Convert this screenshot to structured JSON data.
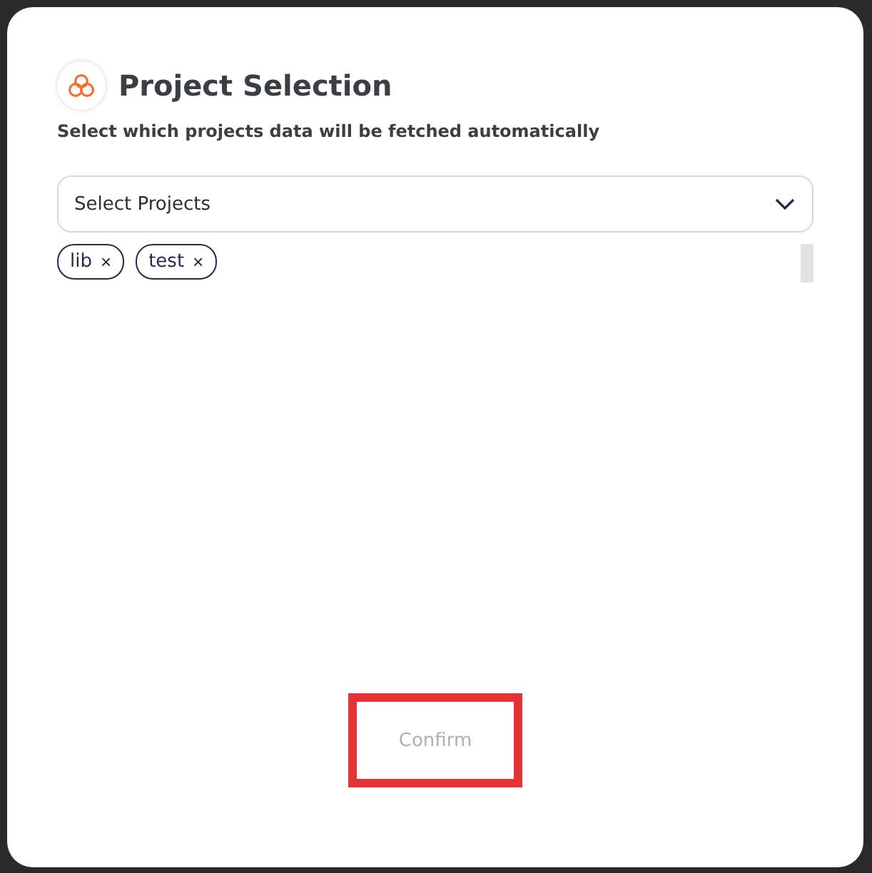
{
  "dialog": {
    "title": "Project Selection",
    "subtitle": "Select which projects data will be fetched automatically"
  },
  "select": {
    "placeholder": "Select Projects",
    "expanded": false
  },
  "chips": [
    {
      "label": "lib",
      "remove": "×"
    },
    {
      "label": "test",
      "remove": "×"
    }
  ],
  "confirm": {
    "label": "Confirm",
    "disabled": true,
    "highlighted": true
  }
}
